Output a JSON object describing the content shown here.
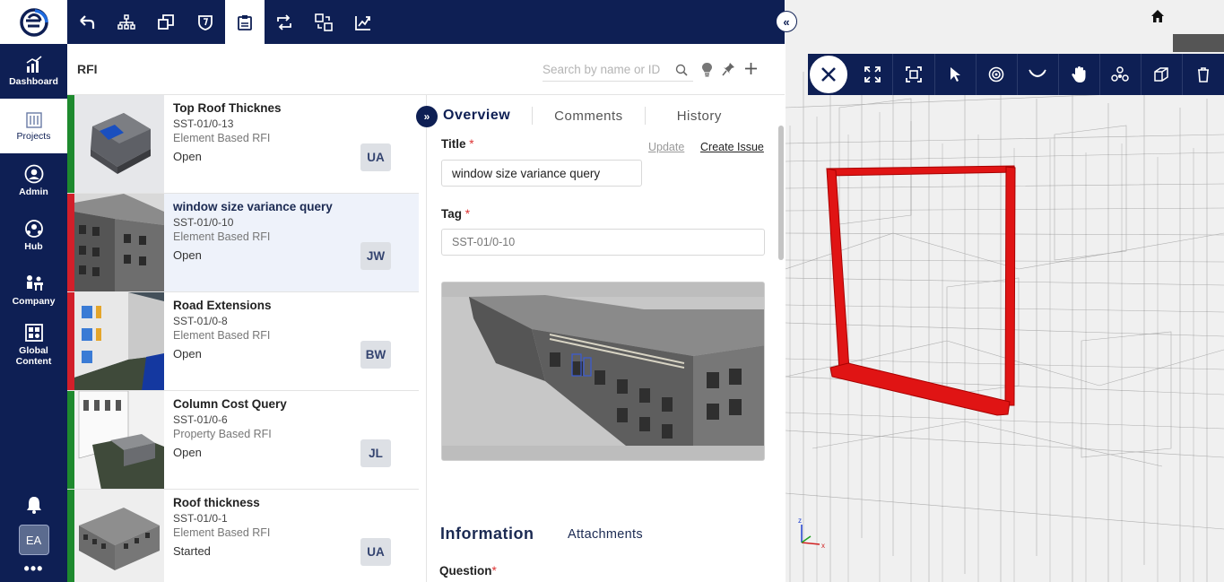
{
  "nav": {
    "items": [
      {
        "label": "Dashboard",
        "icon": "dashboard-chart-icon"
      },
      {
        "label": "Projects",
        "icon": "projects-building-icon"
      },
      {
        "label": "Admin",
        "icon": "admin-user-icon"
      },
      {
        "label": "Hub",
        "icon": "hub-network-icon"
      },
      {
        "label": "Company",
        "icon": "company-people-icon"
      },
      {
        "label": "Global\nContent",
        "icon": "global-content-icon"
      }
    ],
    "avatar": "EA",
    "more": "•••"
  },
  "header": {
    "title": "RFI",
    "search_placeholder": "Search by name or ID"
  },
  "rfis": [
    {
      "title": "Top Roof Thicknes",
      "id": "SST-01/0-13",
      "type": "Element Based RFI",
      "status": "Open",
      "assignee": "UA",
      "color": "#1e8a2e"
    },
    {
      "title": "window size variance query",
      "id": "SST-01/0-10",
      "type": "Element Based RFI",
      "status": "Open",
      "assignee": "JW",
      "color": "#d21f2a"
    },
    {
      "title": "Road Extensions",
      "id": "SST-01/0-8",
      "type": "Element Based RFI",
      "status": "Open",
      "assignee": "BW",
      "color": "#d21f2a"
    },
    {
      "title": "Column Cost Query",
      "id": "SST-01/0-6",
      "type": "Property Based RFI",
      "status": "Open",
      "assignee": "JL",
      "color": "#1e8a2e"
    },
    {
      "title": "Roof thickness",
      "id": "SST-01/0-1",
      "type": "Element Based RFI",
      "status": "Started",
      "assignee": "UA",
      "color": "#1e8a2e"
    }
  ],
  "detail": {
    "tabs": [
      "Overview",
      "Comments",
      "History"
    ],
    "title_label": "Title",
    "required_mark": "*",
    "update_link": "Update",
    "create_issue_link": "Create Issue",
    "title_value": "window size variance query",
    "tag_label": "Tag",
    "tag_value": "SST-01/0-10",
    "section_information": "Information",
    "section_attachments": "Attachments",
    "question_label": "Question"
  },
  "colors": {
    "navy": "#0e1f54",
    "accent_red": "#d21f2a",
    "accent_green": "#1e8a2e"
  }
}
